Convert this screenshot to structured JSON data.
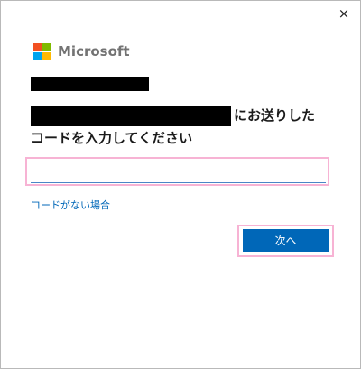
{
  "window": {
    "close_glyph": "×"
  },
  "brand": {
    "name": "Microsoft",
    "logo_colors": [
      "#f25022",
      "#7fba00",
      "#00a4ef",
      "#ffb900"
    ]
  },
  "heading": {
    "line1_suffix": "にお送りした",
    "line2": "コードを入力してください"
  },
  "code_input": {
    "value": "",
    "placeholder": ""
  },
  "links": {
    "no_code": "コードがない場合"
  },
  "buttons": {
    "next": "次へ"
  },
  "colors": {
    "accent": "#0067b8",
    "highlight": "#f7b3d4",
    "redaction": "#000000"
  }
}
